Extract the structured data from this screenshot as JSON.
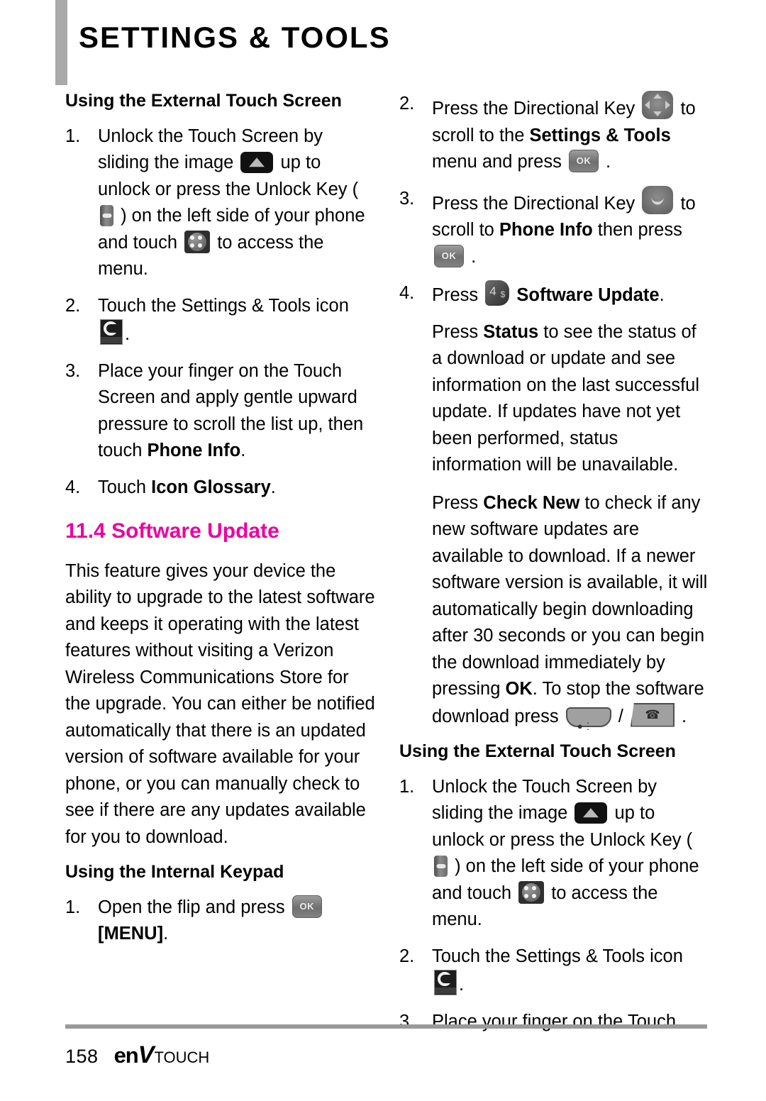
{
  "header": {
    "title": "SETTINGS & TOOLS"
  },
  "colors": {
    "section_heading": "#ec00a0",
    "header_bar": "#a9a9a9",
    "footer_rule": "#9a9a9a"
  },
  "left_column": {
    "subhead_external": "Using the External Touch Screen",
    "steps_external": [
      {
        "num": "1.",
        "parts": [
          {
            "t": "Unlock the Touch Screen by sliding the image "
          },
          {
            "icon": "slide-up-arrow-icon"
          },
          {
            "t": " up to unlock or press the Unlock Key ( "
          },
          {
            "icon": "unlock-key-icon"
          },
          {
            "t": " ) on the left side of your phone and touch "
          },
          {
            "icon": "menu-dots-icon"
          },
          {
            "t": " to access the menu."
          }
        ]
      },
      {
        "num": "2.",
        "parts": [
          {
            "t": "Touch the Settings & Tools icon "
          },
          {
            "icon": "settings-tools-icon"
          },
          {
            "t": "."
          }
        ]
      },
      {
        "num": "3.",
        "parts": [
          {
            "t": "Place your finger on the Touch Screen and apply gentle upward pressure to scroll the list up, then touch "
          },
          {
            "b": "Phone Info"
          },
          {
            "t": "."
          }
        ]
      },
      {
        "num": "4.",
        "parts": [
          {
            "t": "Touch "
          },
          {
            "b": "Icon Glossary"
          },
          {
            "t": "."
          }
        ]
      }
    ],
    "section_heading": "11.4 Software Update",
    "intro_paragraph": "This feature gives your device the ability to upgrade to the latest software and keeps it operating with the latest features without visiting a Verizon Wireless Communications Store for the upgrade. You can either be notified automatically that there is an updated version of software available for your phone, or you can manually check to see if there are any updates available for you to download.",
    "subhead_internal": "Using the Internal Keypad",
    "steps_internal": [
      {
        "num": "1.",
        "parts": [
          {
            "t": "Open the flip and press "
          },
          {
            "icon": "ok-key-icon"
          },
          {
            "t": " "
          },
          {
            "b": "[MENU]"
          },
          {
            "t": "."
          }
        ]
      }
    ]
  },
  "right_column": {
    "steps_internal_cont": [
      {
        "num": "2.",
        "parts": [
          {
            "t": "Press the Directional Key "
          },
          {
            "icon": "directional-key-icon"
          },
          {
            "t": " to scroll to the "
          },
          {
            "b": "Settings & Tools"
          },
          {
            "t": " menu and press "
          },
          {
            "icon": "ok-key-icon"
          },
          {
            "t": " ."
          }
        ]
      },
      {
        "num": "3.",
        "parts": [
          {
            "t": "Press the Directional Key "
          },
          {
            "icon": "directional-key-down-icon"
          },
          {
            "t": " to scroll to "
          },
          {
            "b": "Phone Info"
          },
          {
            "t": " then press "
          },
          {
            "icon": "ok-key-icon"
          },
          {
            "t": " ."
          }
        ]
      },
      {
        "num": "4.",
        "parts": [
          {
            "t": "Press "
          },
          {
            "icon": "key-4-icon"
          },
          {
            "t": " "
          },
          {
            "b": "Software Update"
          },
          {
            "t": "."
          }
        ]
      }
    ],
    "status_paragraph_parts": [
      {
        "t": "Press "
      },
      {
        "b": "Status"
      },
      {
        "t": " to see the status of a download or update and see information on the last successful update. If updates have not yet been performed, status information will be unavailable."
      }
    ],
    "checknew_paragraph_parts": [
      {
        "t": "Press "
      },
      {
        "b": "Check New"
      },
      {
        "t": " to check if any new software updates are available to download. If a newer software version is available, it will automatically begin downloading after 30 seconds or you can begin the download immediately by pressing "
      },
      {
        "b": "OK"
      },
      {
        "t": ". To stop the software download press "
      },
      {
        "icon": "clear-key-icon"
      },
      {
        "t": " / "
      },
      {
        "icon": "end-call-key-icon"
      },
      {
        "t": " ."
      }
    ],
    "subhead_external": "Using the External Touch Screen",
    "steps_external": [
      {
        "num": "1.",
        "parts": [
          {
            "t": "Unlock the Touch Screen by sliding the image "
          },
          {
            "icon": "slide-up-arrow-icon"
          },
          {
            "t": " up to unlock or press the Unlock Key ( "
          },
          {
            "icon": "unlock-key-icon"
          },
          {
            "t": " ) on the left side of your phone and touch "
          },
          {
            "icon": "menu-dots-icon"
          },
          {
            "t": " to access the menu."
          }
        ]
      },
      {
        "num": "2.",
        "parts": [
          {
            "t": "Touch the Settings & Tools icon "
          },
          {
            "icon": "settings-tools-icon"
          },
          {
            "t": "."
          }
        ]
      },
      {
        "num": "3.",
        "parts": [
          {
            "t": "Place your finger on the Touch"
          }
        ]
      }
    ]
  },
  "footer": {
    "page_number": "158",
    "brand_en": "en",
    "brand_v": "V",
    "brand_touch": "TOUCH"
  }
}
